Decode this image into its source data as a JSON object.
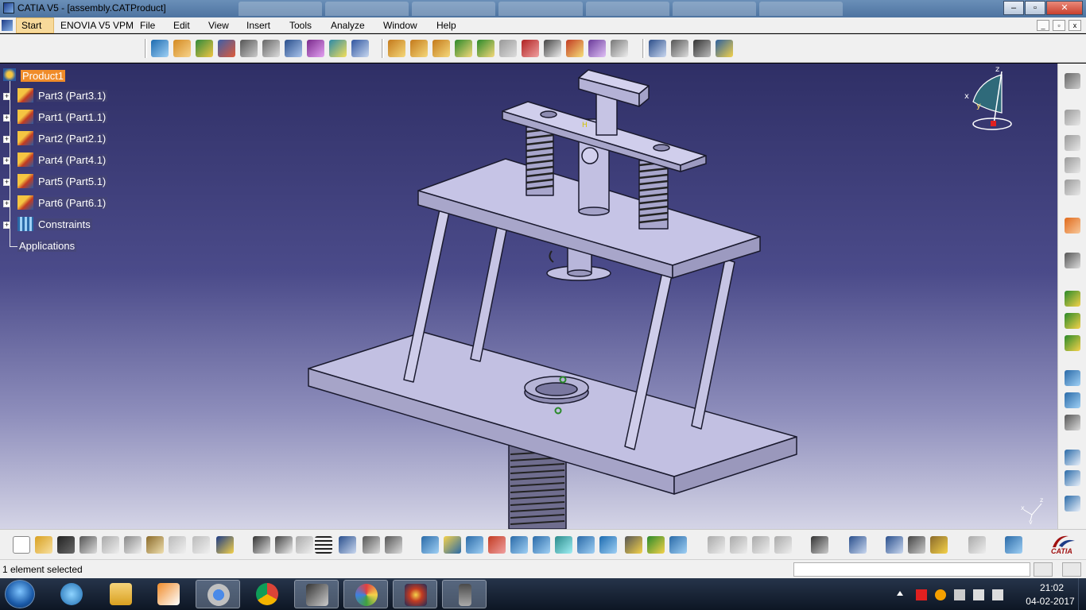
{
  "window": {
    "title": "CATIA V5 - [assembly.CATProduct]",
    "minimize": "–",
    "maximize": "▫",
    "close": "✕"
  },
  "menu": {
    "start": "Start",
    "items": [
      "ENOVIA V5 VPM",
      "File",
      "Edit",
      "View",
      "Insert",
      "Tools",
      "Analyze",
      "Window",
      "Help"
    ]
  },
  "tree": {
    "root": "Product1",
    "nodes": [
      {
        "label": "Part3 (Part3.1)",
        "icon": "part-instance-icon"
      },
      {
        "label": "Part1 (Part1.1)",
        "icon": "part-instance-icon"
      },
      {
        "label": "Part2 (Part2.1)",
        "icon": "part-instance-icon"
      },
      {
        "label": "Part4 (Part4.1)",
        "icon": "part-instance-icon"
      },
      {
        "label": "Part5 (Part5.1)",
        "icon": "part-instance-icon"
      },
      {
        "label": "Part6 (Part6.1)",
        "icon": "part-instance-icon"
      },
      {
        "label": "Constraints",
        "icon": "constraints-icon"
      }
    ],
    "applications": "Applications"
  },
  "compass": {
    "x": "x",
    "y": "y",
    "z": "z"
  },
  "status": {
    "message": "1 element selected",
    "power_input": ""
  },
  "taskbar": {
    "time": "21:02",
    "date": "04-02-2017",
    "apps": [
      "internet-explorer",
      "file-explorer",
      "media-player",
      "chrome-alt",
      "chrome",
      "app-launcher",
      "paint",
      "catia",
      "phone-app"
    ]
  },
  "colors": {
    "selection": "#f08c2a",
    "viewport_top": "#2f2f66",
    "viewport_bottom": "#d4d4e6",
    "model_face": "#b8b6dc"
  },
  "brand": "CATIA"
}
